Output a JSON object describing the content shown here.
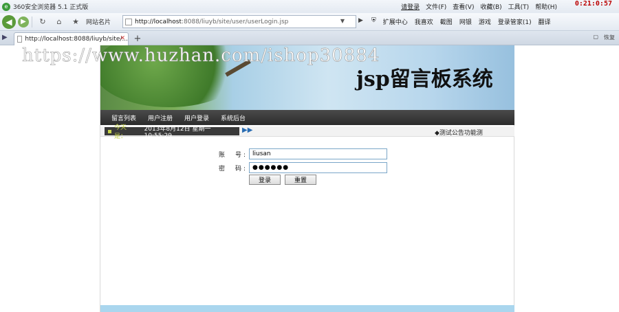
{
  "browser": {
    "title": "360安全浏览器 5.1 正式版",
    "login_link": "请登录",
    "menus": [
      "文件(F)",
      "查看(V)",
      "收藏(B)",
      "工具(T)",
      "帮助(H)"
    ],
    "clock": "0:21:0:57",
    "fav_label": "网站名片",
    "address_host": "http://localhost",
    "address_rest": ":8088/liuyb/site/user/userLogin.jsp",
    "tools": [
      "扩展中心",
      "我喜欢",
      "截图",
      "网银",
      "游戏",
      "登录管家(1)",
      "翻译"
    ],
    "tab_title": "http://localhost:8088/liuyb/site/...",
    "tab_right": [
      "恢复"
    ]
  },
  "page": {
    "watermark": "https://www.huzhan.com/ishop30884",
    "banner_title": "jsp留言板系统",
    "menu": [
      "留言列表",
      "用户注册",
      "用户登录",
      "系统后台"
    ],
    "date_label": "今天是：",
    "date_value": "2013年8月12日 星期一 10:55:29",
    "notice": "◆测试公告功能测",
    "form": {
      "account_label": "账　号:",
      "account_value": "liusan",
      "password_label": "密　码:",
      "password_value": "●●●●●●",
      "login_button": "登录",
      "reset_button": "重置"
    }
  }
}
